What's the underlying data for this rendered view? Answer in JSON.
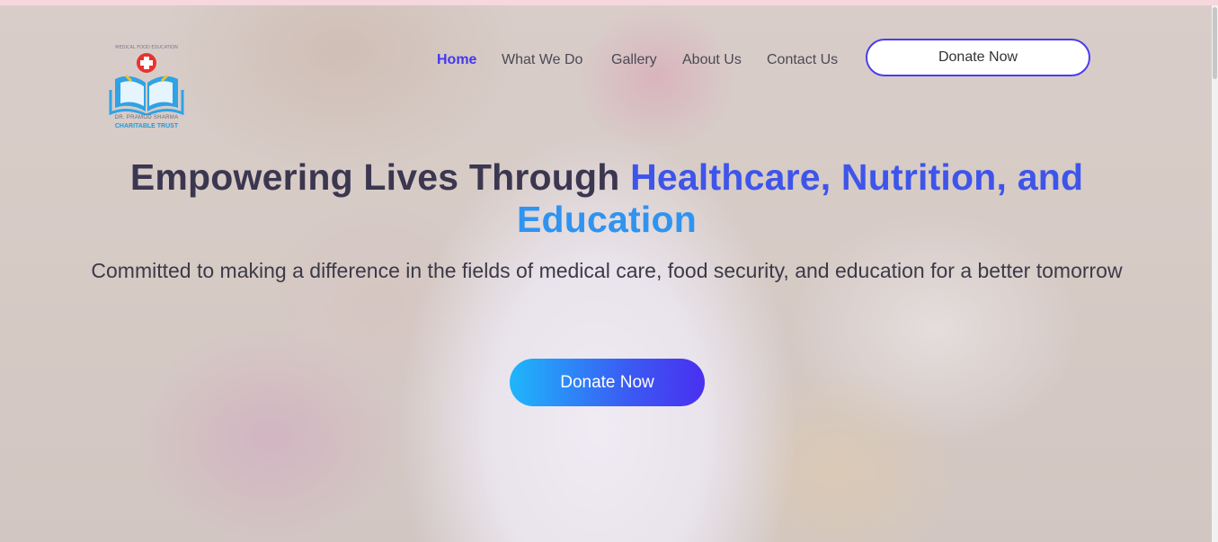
{
  "brand": {
    "logo_top_text": "MEDICAL    FOOD    EDUCATION",
    "logo_name": "DR. PRAMOD SHARMA",
    "logo_trust": "CHARITABLE TRUST"
  },
  "nav": {
    "items": [
      {
        "label": "Home",
        "active": true
      },
      {
        "label": "What We Do",
        "active": false
      },
      {
        "label": "Gallery",
        "active": false
      },
      {
        "label": "About Us",
        "active": false
      },
      {
        "label": "Contact Us",
        "active": false
      }
    ],
    "donate_label": "Donate Now"
  },
  "hero": {
    "headline_plain": "Empowering Lives Through ",
    "headline_highlight": "Healthcare, Nutrition, and",
    "headline_highlight2": "Education",
    "subheadline": "Committed to making a difference in the fields of medical care, food security, and education for a better tomorrow",
    "cta_label": "Donate Now"
  },
  "colors": {
    "accent": "#4338ee",
    "headline_highlight": "#3e55ea",
    "cta_gradient_start": "#1fb6fb",
    "cta_gradient_end": "#4a2ff0"
  }
}
